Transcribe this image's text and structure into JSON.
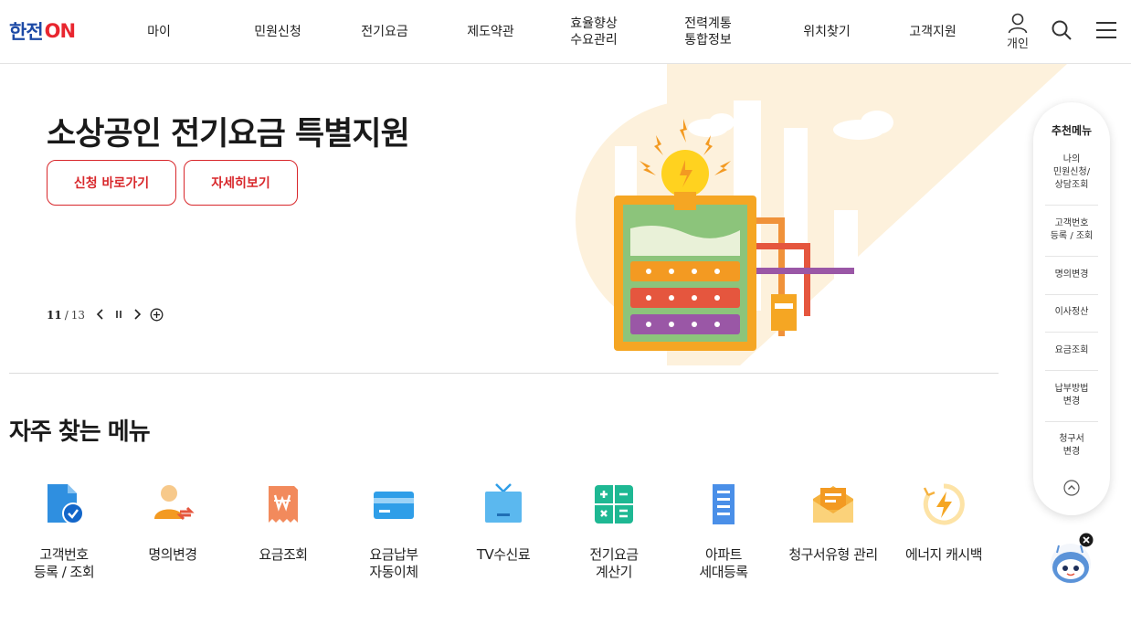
{
  "header": {
    "logo_main": "한전",
    "logo_on": "ON",
    "nav": [
      {
        "lines": [
          "마이"
        ]
      },
      {
        "lines": [
          "민원신청"
        ]
      },
      {
        "lines": [
          "전기요금"
        ]
      },
      {
        "lines": [
          "제도약관"
        ]
      },
      {
        "lines": [
          "효율향상",
          "수요관리"
        ]
      },
      {
        "lines": [
          "전력계통",
          "통합정보"
        ]
      },
      {
        "lines": [
          "위치찾기"
        ]
      },
      {
        "lines": [
          "고객지원"
        ]
      }
    ],
    "login_label": "개인",
    "icons": {
      "user": "user-icon",
      "search": "search-icon",
      "menu": "hamburger-menu-icon"
    }
  },
  "hero": {
    "title": "소상공인 전기요금 특별지원",
    "buttons": [
      "신청 바로가기",
      "자세히보기"
    ],
    "pager": {
      "current": "11",
      "separator": "/",
      "total": "13"
    },
    "accent_color": "#d8272b"
  },
  "frequent_menu": {
    "title": "자주 찾는 메뉴",
    "items": [
      {
        "lines": [
          "고객번호",
          "등록 / 조회"
        ],
        "icon": "document-check-icon"
      },
      {
        "lines": [
          "명의변경"
        ],
        "icon": "person-change-icon"
      },
      {
        "lines": [
          "요금조회"
        ],
        "icon": "won-receipt-icon"
      },
      {
        "lines": [
          "요금납부",
          "자동이체"
        ],
        "icon": "credit-card-icon"
      },
      {
        "lines": [
          "TV수신료"
        ],
        "icon": "tv-icon"
      },
      {
        "lines": [
          "전기요금",
          "계산기"
        ],
        "icon": "calculator-icon"
      },
      {
        "lines": [
          "아파트",
          "세대등록"
        ],
        "icon": "apartment-icon"
      },
      {
        "lines": [
          "청구서유형 관리"
        ],
        "icon": "envelope-icon"
      },
      {
        "lines": [
          "에너지 캐시백"
        ],
        "icon": "energy-cashback-icon"
      }
    ]
  },
  "quick_menu": {
    "title": "추천메뉴",
    "items": [
      {
        "lines": [
          "나의",
          "민원신청/",
          "상담조회"
        ]
      },
      {
        "lines": [
          "고객번호",
          "등록 / 조회"
        ]
      },
      {
        "lines": [
          "명의변경"
        ]
      },
      {
        "lines": [
          "이사정산"
        ]
      },
      {
        "lines": [
          "요금조회"
        ]
      },
      {
        "lines": [
          "납부방법",
          "변경"
        ]
      },
      {
        "lines": [
          "청구서",
          "변경"
        ]
      }
    ]
  }
}
